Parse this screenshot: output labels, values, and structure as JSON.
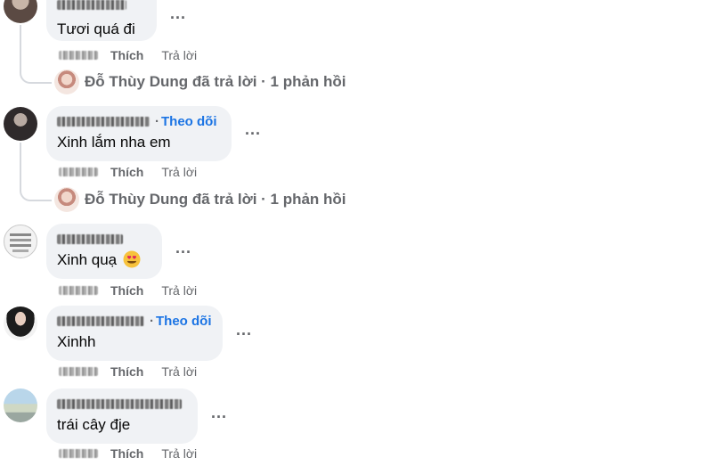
{
  "comments": [
    {
      "text": "Tươi quá đi",
      "like_label": "Thích",
      "reply_label": "Trả lời",
      "more_label": "...",
      "reply_summary": "Đỗ Thùy Dung đã trả lời · 1 phản hồi"
    },
    {
      "follow_label": "Theo dõi",
      "follow_dot": "·",
      "text": "Xinh lắm nha em",
      "like_label": "Thích",
      "reply_label": "Trả lời",
      "more_label": "...",
      "reply_summary": "Đỗ Thùy Dung đã trả lời · 1 phản hồi"
    },
    {
      "text": "Xinh quạ",
      "emoji": "heart-eyes-emoji",
      "like_label": "Thích",
      "reply_label": "Trả lời",
      "more_label": "..."
    },
    {
      "follow_label": "Theo dõi",
      "follow_dot": "·",
      "text": "Xinhh",
      "like_label": "Thích",
      "reply_label": "Trả lời",
      "more_label": "..."
    },
    {
      "text": "trái cây đje",
      "like_label": "Thích",
      "reply_label": "Trả lời",
      "more_label": "..."
    }
  ],
  "colors": {
    "bubble": "#f0f2f5",
    "meta_text": "#65676b",
    "link": "#1b74e4",
    "thread_line": "#d6d9de"
  }
}
